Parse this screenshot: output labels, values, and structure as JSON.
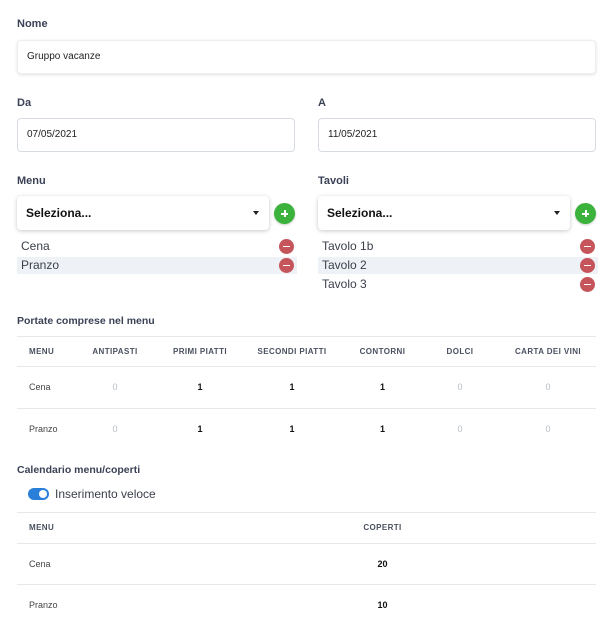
{
  "form": {
    "name_label": "Nome",
    "name_value": "Gruppo vacanze",
    "from_label": "Da",
    "from_value": "07/05/2021",
    "to_label": "A",
    "to_value": "11/05/2021"
  },
  "menu_section": {
    "label": "Menu",
    "select_value": "Seleziona...",
    "items": [
      "Cena",
      "Pranzo"
    ]
  },
  "tables_section": {
    "label": "Tavoli",
    "select_value": "Seleziona...",
    "items": [
      "Tavolo 1b",
      "Tavolo 2",
      "Tavolo 3"
    ]
  },
  "courses": {
    "title": "Portate comprese nel menu",
    "headers": [
      "MENU",
      "ANTIPASTI",
      "PRIMI PIATTI",
      "SECONDI PIATTI",
      "CONTORNI",
      "DOLCI",
      "CARTA DEI VINI"
    ],
    "rows": [
      {
        "name": "Cena",
        "values": [
          "0",
          "1",
          "1",
          "1",
          "0",
          "0"
        ]
      },
      {
        "name": "Pranzo",
        "values": [
          "0",
          "1",
          "1",
          "1",
          "0",
          "0"
        ]
      }
    ]
  },
  "calendar": {
    "title": "Calendario menu/coperti",
    "toggle_label": "Inserimento veloce",
    "toggle_on": true,
    "headers": [
      "MENU",
      "COPERTI"
    ],
    "rows": [
      {
        "name": "Cena",
        "covers": "20"
      },
      {
        "name": "Pranzo",
        "covers": "10"
      }
    ]
  },
  "colors": {
    "add": "#3bb23b",
    "remove": "#c5555a",
    "toggle": "#2a7fd8"
  },
  "icons": {
    "add": "plus-circle-icon",
    "remove": "minus-circle-icon",
    "dropdown": "chevron-down-icon"
  }
}
